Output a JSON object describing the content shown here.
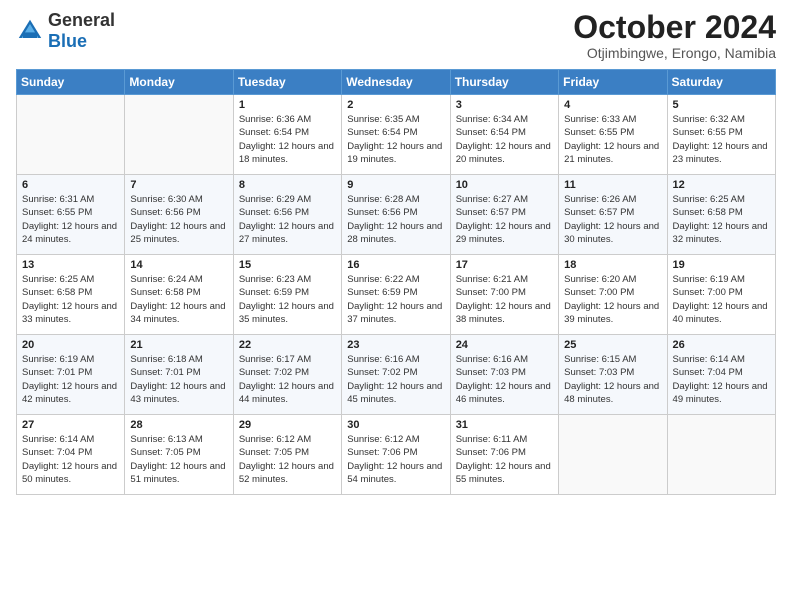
{
  "logo": {
    "general": "General",
    "blue": "Blue"
  },
  "header": {
    "month": "October 2024",
    "location": "Otjimbingwe, Erongo, Namibia"
  },
  "days_of_week": [
    "Sunday",
    "Monday",
    "Tuesday",
    "Wednesday",
    "Thursday",
    "Friday",
    "Saturday"
  ],
  "weeks": [
    [
      {
        "day": "",
        "sunrise": "",
        "sunset": "",
        "daylight": ""
      },
      {
        "day": "",
        "sunrise": "",
        "sunset": "",
        "daylight": ""
      },
      {
        "day": "1",
        "sunrise": "Sunrise: 6:36 AM",
        "sunset": "Sunset: 6:54 PM",
        "daylight": "Daylight: 12 hours and 18 minutes."
      },
      {
        "day": "2",
        "sunrise": "Sunrise: 6:35 AM",
        "sunset": "Sunset: 6:54 PM",
        "daylight": "Daylight: 12 hours and 19 minutes."
      },
      {
        "day": "3",
        "sunrise": "Sunrise: 6:34 AM",
        "sunset": "Sunset: 6:54 PM",
        "daylight": "Daylight: 12 hours and 20 minutes."
      },
      {
        "day": "4",
        "sunrise": "Sunrise: 6:33 AM",
        "sunset": "Sunset: 6:55 PM",
        "daylight": "Daylight: 12 hours and 21 minutes."
      },
      {
        "day": "5",
        "sunrise": "Sunrise: 6:32 AM",
        "sunset": "Sunset: 6:55 PM",
        "daylight": "Daylight: 12 hours and 23 minutes."
      }
    ],
    [
      {
        "day": "6",
        "sunrise": "Sunrise: 6:31 AM",
        "sunset": "Sunset: 6:55 PM",
        "daylight": "Daylight: 12 hours and 24 minutes."
      },
      {
        "day": "7",
        "sunrise": "Sunrise: 6:30 AM",
        "sunset": "Sunset: 6:56 PM",
        "daylight": "Daylight: 12 hours and 25 minutes."
      },
      {
        "day": "8",
        "sunrise": "Sunrise: 6:29 AM",
        "sunset": "Sunset: 6:56 PM",
        "daylight": "Daylight: 12 hours and 27 minutes."
      },
      {
        "day": "9",
        "sunrise": "Sunrise: 6:28 AM",
        "sunset": "Sunset: 6:56 PM",
        "daylight": "Daylight: 12 hours and 28 minutes."
      },
      {
        "day": "10",
        "sunrise": "Sunrise: 6:27 AM",
        "sunset": "Sunset: 6:57 PM",
        "daylight": "Daylight: 12 hours and 29 minutes."
      },
      {
        "day": "11",
        "sunrise": "Sunrise: 6:26 AM",
        "sunset": "Sunset: 6:57 PM",
        "daylight": "Daylight: 12 hours and 30 minutes."
      },
      {
        "day": "12",
        "sunrise": "Sunrise: 6:25 AM",
        "sunset": "Sunset: 6:58 PM",
        "daylight": "Daylight: 12 hours and 32 minutes."
      }
    ],
    [
      {
        "day": "13",
        "sunrise": "Sunrise: 6:25 AM",
        "sunset": "Sunset: 6:58 PM",
        "daylight": "Daylight: 12 hours and 33 minutes."
      },
      {
        "day": "14",
        "sunrise": "Sunrise: 6:24 AM",
        "sunset": "Sunset: 6:58 PM",
        "daylight": "Daylight: 12 hours and 34 minutes."
      },
      {
        "day": "15",
        "sunrise": "Sunrise: 6:23 AM",
        "sunset": "Sunset: 6:59 PM",
        "daylight": "Daylight: 12 hours and 35 minutes."
      },
      {
        "day": "16",
        "sunrise": "Sunrise: 6:22 AM",
        "sunset": "Sunset: 6:59 PM",
        "daylight": "Daylight: 12 hours and 37 minutes."
      },
      {
        "day": "17",
        "sunrise": "Sunrise: 6:21 AM",
        "sunset": "Sunset: 7:00 PM",
        "daylight": "Daylight: 12 hours and 38 minutes."
      },
      {
        "day": "18",
        "sunrise": "Sunrise: 6:20 AM",
        "sunset": "Sunset: 7:00 PM",
        "daylight": "Daylight: 12 hours and 39 minutes."
      },
      {
        "day": "19",
        "sunrise": "Sunrise: 6:19 AM",
        "sunset": "Sunset: 7:00 PM",
        "daylight": "Daylight: 12 hours and 40 minutes."
      }
    ],
    [
      {
        "day": "20",
        "sunrise": "Sunrise: 6:19 AM",
        "sunset": "Sunset: 7:01 PM",
        "daylight": "Daylight: 12 hours and 42 minutes."
      },
      {
        "day": "21",
        "sunrise": "Sunrise: 6:18 AM",
        "sunset": "Sunset: 7:01 PM",
        "daylight": "Daylight: 12 hours and 43 minutes."
      },
      {
        "day": "22",
        "sunrise": "Sunrise: 6:17 AM",
        "sunset": "Sunset: 7:02 PM",
        "daylight": "Daylight: 12 hours and 44 minutes."
      },
      {
        "day": "23",
        "sunrise": "Sunrise: 6:16 AM",
        "sunset": "Sunset: 7:02 PM",
        "daylight": "Daylight: 12 hours and 45 minutes."
      },
      {
        "day": "24",
        "sunrise": "Sunrise: 6:16 AM",
        "sunset": "Sunset: 7:03 PM",
        "daylight": "Daylight: 12 hours and 46 minutes."
      },
      {
        "day": "25",
        "sunrise": "Sunrise: 6:15 AM",
        "sunset": "Sunset: 7:03 PM",
        "daylight": "Daylight: 12 hours and 48 minutes."
      },
      {
        "day": "26",
        "sunrise": "Sunrise: 6:14 AM",
        "sunset": "Sunset: 7:04 PM",
        "daylight": "Daylight: 12 hours and 49 minutes."
      }
    ],
    [
      {
        "day": "27",
        "sunrise": "Sunrise: 6:14 AM",
        "sunset": "Sunset: 7:04 PM",
        "daylight": "Daylight: 12 hours and 50 minutes."
      },
      {
        "day": "28",
        "sunrise": "Sunrise: 6:13 AM",
        "sunset": "Sunset: 7:05 PM",
        "daylight": "Daylight: 12 hours and 51 minutes."
      },
      {
        "day": "29",
        "sunrise": "Sunrise: 6:12 AM",
        "sunset": "Sunset: 7:05 PM",
        "daylight": "Daylight: 12 hours and 52 minutes."
      },
      {
        "day": "30",
        "sunrise": "Sunrise: 6:12 AM",
        "sunset": "Sunset: 7:06 PM",
        "daylight": "Daylight: 12 hours and 54 minutes."
      },
      {
        "day": "31",
        "sunrise": "Sunrise: 6:11 AM",
        "sunset": "Sunset: 7:06 PM",
        "daylight": "Daylight: 12 hours and 55 minutes."
      },
      {
        "day": "",
        "sunrise": "",
        "sunset": "",
        "daylight": ""
      },
      {
        "day": "",
        "sunrise": "",
        "sunset": "",
        "daylight": ""
      }
    ]
  ]
}
